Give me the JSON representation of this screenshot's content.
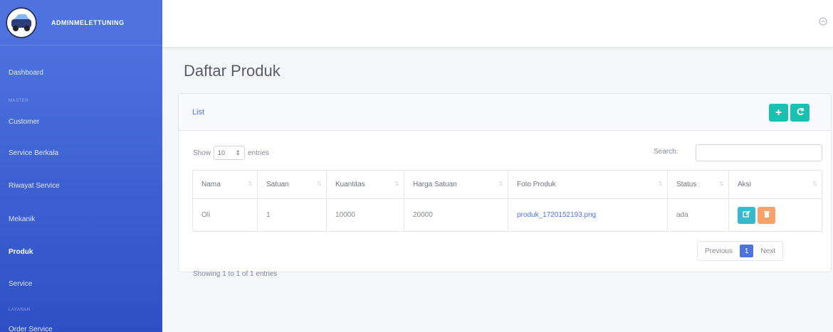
{
  "brand": {
    "name": "ADMINMELETTUNING"
  },
  "sidebar": {
    "items": [
      {
        "label": "Dashboard"
      },
      {
        "label": "Customer"
      },
      {
        "label": "Service Berkala"
      },
      {
        "label": "Riwayat Service"
      },
      {
        "label": "Mekanik"
      },
      {
        "label": "Produk"
      },
      {
        "label": "Service"
      },
      {
        "label": "Order Service"
      }
    ],
    "headings": [
      "MASTER",
      "LAYANAN"
    ]
  },
  "page": {
    "title": "Daftar Produk"
  },
  "card": {
    "title": "List"
  },
  "datatable": {
    "show_label": "Show",
    "entries_value": "10",
    "entries_label": "entries",
    "search_label": "Search:",
    "columns": [
      "Nama",
      "Satuan",
      "Kuantitas",
      "Harga Satuan",
      "Foto Produk",
      "Status",
      "Aksi"
    ],
    "rows": [
      {
        "nama": "Oli",
        "satuan": "1",
        "kuantitas": "10000",
        "harga": "20000",
        "foto": "produk_1720152193.png",
        "status": "ada"
      }
    ],
    "info": "Showing 1 to 1 of 1 entries",
    "pagination": {
      "previous": "Previous",
      "current": "1",
      "next": "Next"
    }
  },
  "colors": {
    "primary": "#4e73df",
    "teal": "#1cc0b0",
    "info": "#36b9cc",
    "warning": "#f6a26a"
  },
  "icons": {
    "add": "plus-icon",
    "refresh": "refresh-icon",
    "edit": "edit-icon",
    "delete": "trash-icon",
    "topbar": "user-icon"
  }
}
